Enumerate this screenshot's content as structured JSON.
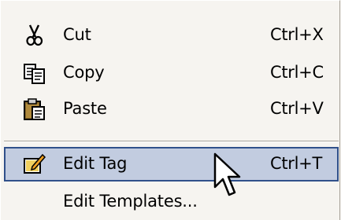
{
  "context_menu": {
    "items": [
      {
        "label": "Cut",
        "shortcut": "Ctrl+X",
        "icon": "scissors-icon"
      },
      {
        "label": "Copy",
        "shortcut": "Ctrl+C",
        "icon": "copy-icon"
      },
      {
        "label": "Paste",
        "shortcut": "Ctrl+V",
        "icon": "paste-icon"
      },
      {
        "label": "Edit Tag",
        "shortcut": "Ctrl+T",
        "icon": "edit-tag-icon",
        "highlighted": true
      },
      {
        "label": "Edit Templates...",
        "shortcut": "",
        "icon": ""
      }
    ],
    "highlight_color": "#c2cce0",
    "highlight_border_color": "#30508a",
    "background_color": "#f6f4f0"
  },
  "cursor": {
    "icon": "arrow-cursor-icon"
  }
}
